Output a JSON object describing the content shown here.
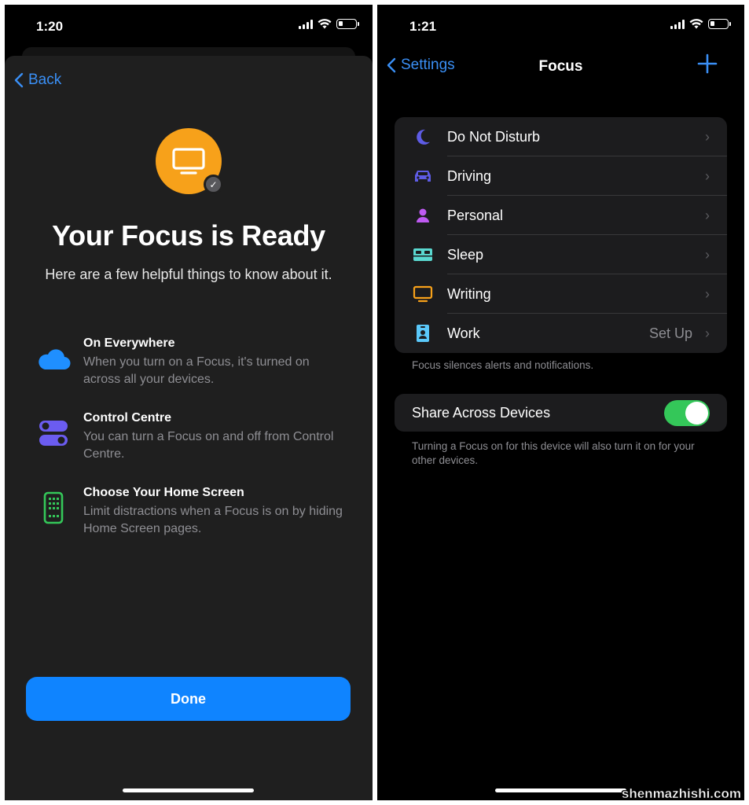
{
  "left_screen": {
    "status_time": "1:20",
    "back_label": "Back",
    "title": "Your Focus is Ready",
    "subtitle": "Here are a few helpful things to know about it.",
    "hero_icon": "tv-monitor-icon",
    "hero_color": "#f7a11a",
    "features": [
      {
        "title": "On Everywhere",
        "desc": "When you turn on a Focus, it's turned on across all your devices.",
        "icon": "cloud-icon",
        "color": "#1f8fff"
      },
      {
        "title": "Control Centre",
        "desc": "You can turn a Focus on and off from Control Centre.",
        "icon": "toggles-icon",
        "color": "#6b5cf0"
      },
      {
        "title": "Choose Your Home Screen",
        "desc": "Limit distractions when a Focus is on by hiding Home Screen pages.",
        "icon": "phone-home-screen-icon",
        "color": "#34c759"
      }
    ],
    "done_label": "Done"
  },
  "right_screen": {
    "status_time": "1:21",
    "nav_back_label": "Settings",
    "nav_title": "Focus",
    "focus_modes": [
      {
        "label": "Do Not Disturb",
        "value": "",
        "icon": "moon-icon",
        "color": "#5e5ce6"
      },
      {
        "label": "Driving",
        "value": "",
        "icon": "car-icon",
        "color": "#5e5ce6"
      },
      {
        "label": "Personal",
        "value": "",
        "icon": "person-icon",
        "color": "#bf5af2"
      },
      {
        "label": "Sleep",
        "value": "",
        "icon": "bed-icon",
        "color": "#5ad8d0"
      },
      {
        "label": "Writing",
        "value": "",
        "icon": "monitor-icon",
        "color": "#f7a11a"
      },
      {
        "label": "Work",
        "value": "Set Up",
        "icon": "id-badge-icon",
        "color": "#5ac8fa"
      }
    ],
    "focus_footnote": "Focus silences alerts and notifications.",
    "share_label": "Share Across Devices",
    "share_enabled": true,
    "share_footnote": "Turning a Focus on for this device will also turn it on for your other devices."
  },
  "watermark": "shenmazhishi.com",
  "colors": {
    "accent": "#0f84ff",
    "link": "#3a8ff5",
    "toggle_on": "#34c759"
  }
}
